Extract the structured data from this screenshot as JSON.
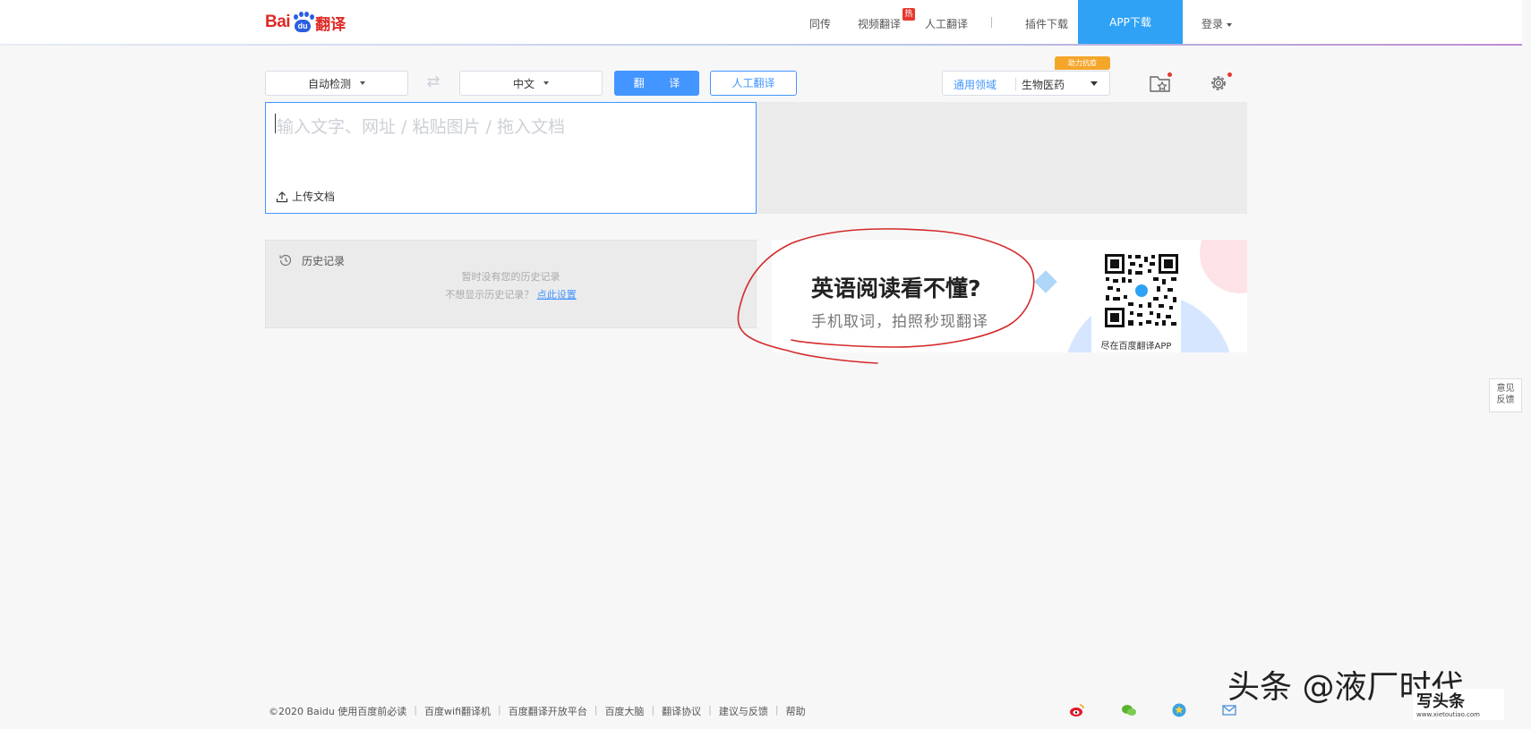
{
  "header": {
    "logo_text_bai": "Bai",
    "logo_text_du": "du",
    "logo_text_fanyi": "翻译",
    "nav": {
      "simultaneous": "同传",
      "video_translate": "视频翻译",
      "hot_badge": "热",
      "human_translate": "人工翻译",
      "plugin_download": "插件下载",
      "app_download": "APP下载",
      "login": "登录"
    }
  },
  "toolbar": {
    "source_lang": "自动检测",
    "target_lang": "中文",
    "translate_button": "翻 译",
    "human_translate_button": "人工翻译",
    "domain_general": "通用领域",
    "domain_selected": "生物医药",
    "assist_badge": "助力抗疫"
  },
  "input": {
    "placeholder": "输入文字、网址 / 粘贴图片 / 拖入文档",
    "upload_label": "上传文档"
  },
  "history": {
    "title": "历史记录",
    "empty_message": "暂时没有您的历史记录",
    "hide_prompt": "不想显示历史记录？",
    "settings_link": "点此设置"
  },
  "ad": {
    "title": "英语阅读看不懂?",
    "subtitle": "手机取词，拍照秒现翻译",
    "qr_caption": "尽在百度翻译APP"
  },
  "feedback": {
    "line1": "意见",
    "line2": "反馈"
  },
  "footer": {
    "links": [
      "©2020 Baidu  使用百度前必读",
      "百度wifi翻译机",
      "百度翻译开放平台",
      "百度大脑",
      "翻译协议",
      "建议与反馈",
      "帮助"
    ]
  },
  "watermark": {
    "text": "头条 @液厂时代",
    "logo_text": "写头条",
    "logo_url": "www.xietoutiao.com"
  },
  "colors": {
    "brand_blue": "#4395ff",
    "app_download_bg": "#2fa2f5",
    "annotation_red": "#d42a2a",
    "logo_red": "#de2925"
  }
}
